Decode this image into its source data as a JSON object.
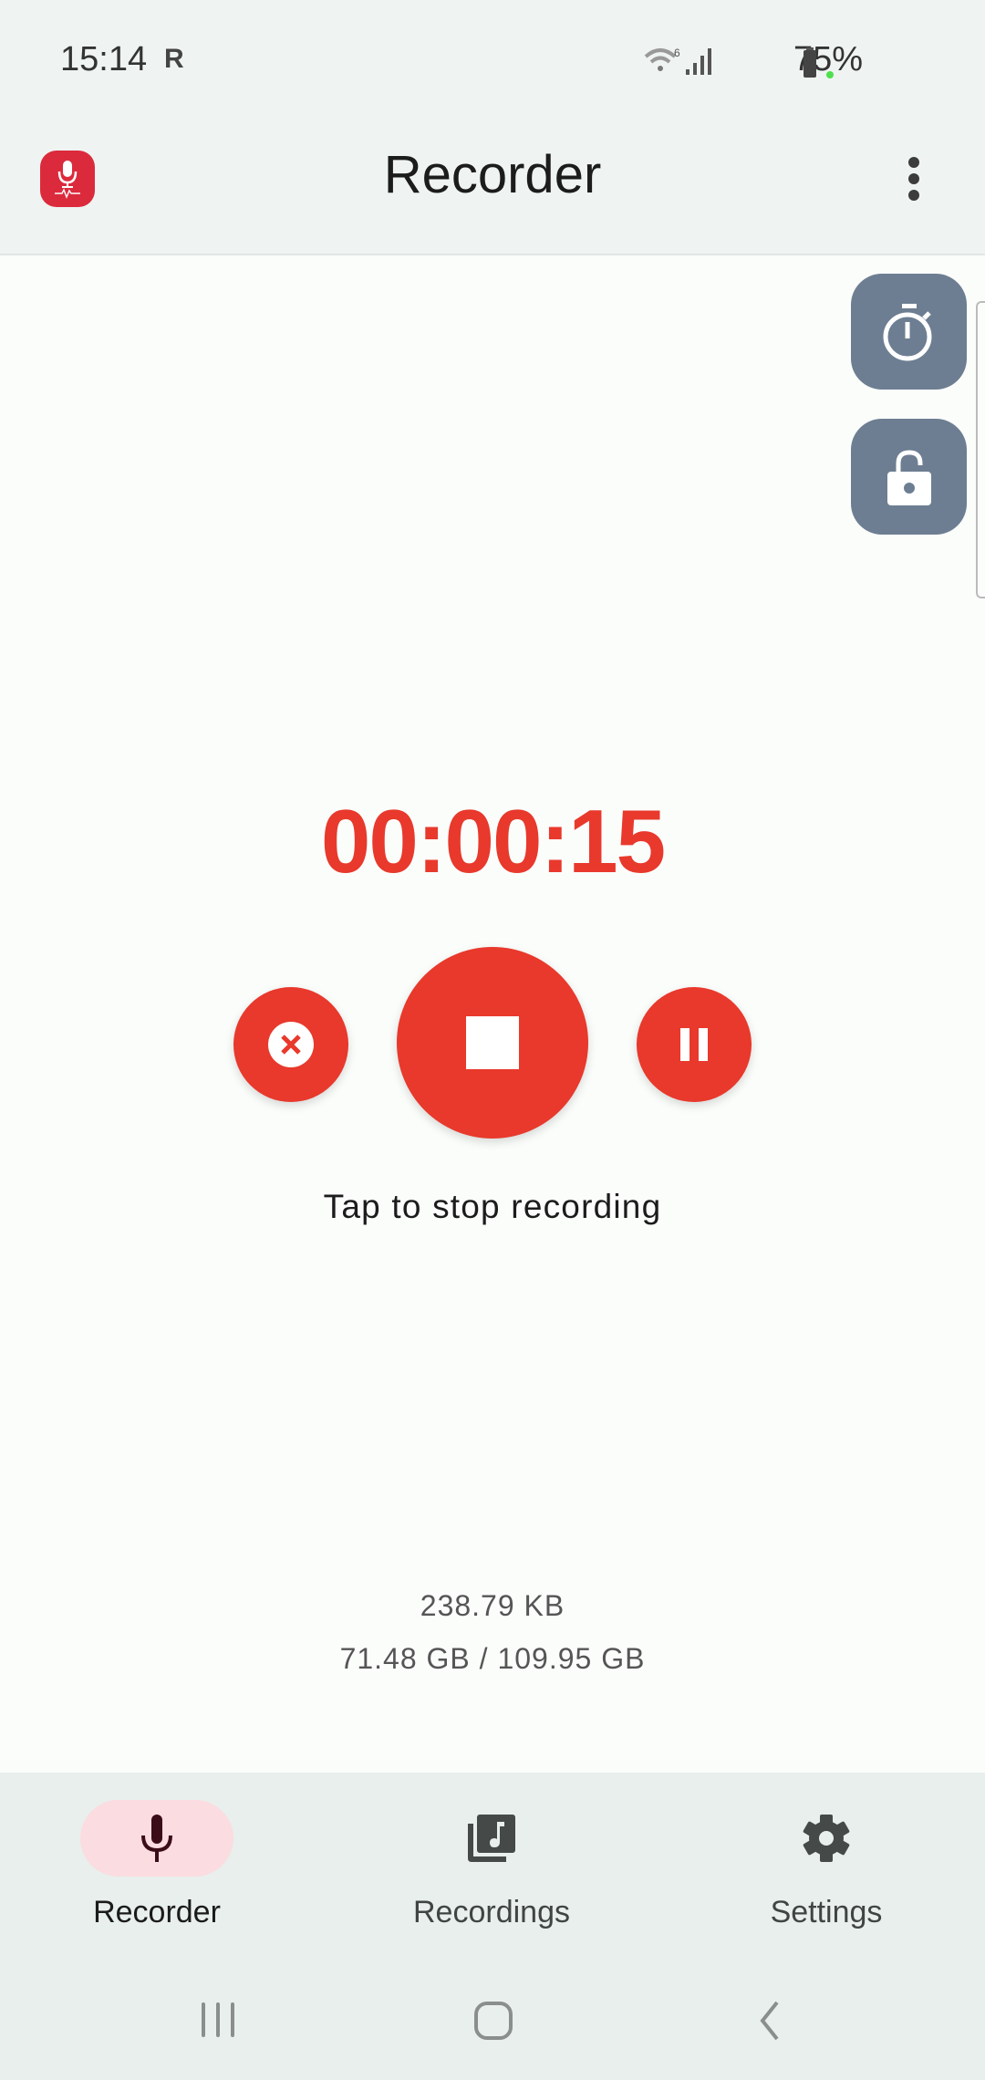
{
  "status_bar": {
    "time": "15:14",
    "notification_icon": "R",
    "battery": "75%"
  },
  "app_bar": {
    "title": "Recorder",
    "icon": "microphone-app-icon",
    "menu_icon": "more-vert-icon"
  },
  "side_buttons": [
    {
      "icon": "timer-icon"
    },
    {
      "icon": "unlock-icon"
    }
  ],
  "recorder": {
    "elapsed": "00:00:15",
    "hint": "Tap to stop recording",
    "file_size": "238.79 KB",
    "storage": "71.48 GB / 109.95 GB",
    "accent_color": "#e8392c"
  },
  "bottom_nav": {
    "items": [
      {
        "label": "Recorder",
        "icon": "mic-icon",
        "active": true
      },
      {
        "label": "Recordings",
        "icon": "library-music-icon",
        "active": false
      },
      {
        "label": "Settings",
        "icon": "gear-icon",
        "active": false
      }
    ]
  }
}
